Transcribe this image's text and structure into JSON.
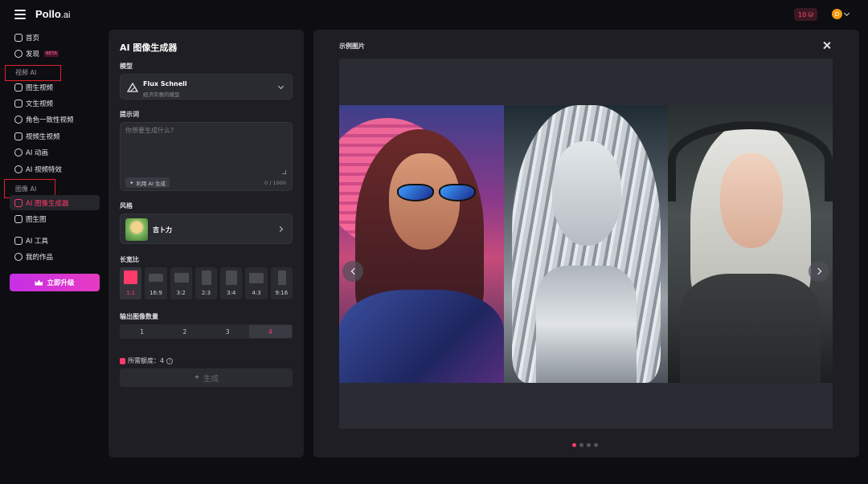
{
  "app": {
    "logo": "Pollo",
    "logo_suffix": ".ai",
    "credits": "10",
    "user_initial": "D"
  },
  "sidebar": {
    "items_top": [
      {
        "label": "首页",
        "icon": "home-icon"
      },
      {
        "label": "发现",
        "icon": "compass-icon",
        "badge": "BETA"
      }
    ],
    "video_section": "视频 AI",
    "video_items": [
      {
        "label": "图生视频",
        "icon": "image-video-icon"
      },
      {
        "label": "文生视频",
        "icon": "text-video-icon"
      },
      {
        "label": "角色一致性视频",
        "icon": "character-icon"
      },
      {
        "label": "视频生视频",
        "icon": "video-video-icon"
      },
      {
        "label": "AI 动画",
        "icon": "animation-icon"
      },
      {
        "label": "AI 视频特效",
        "icon": "effects-icon"
      }
    ],
    "image_section": "图像 AI",
    "image_items": [
      {
        "label": "AI 图像生成器",
        "icon": "image-generator-icon",
        "active": true
      },
      {
        "label": "图生图",
        "icon": "image-to-image-icon"
      }
    ],
    "bottom_items": [
      {
        "label": "AI 工具",
        "icon": "toolbox-icon"
      },
      {
        "label": "我的作品",
        "icon": "user-works-icon"
      }
    ],
    "upgrade": "立即升级"
  },
  "form": {
    "title": "AI 图像生成器",
    "model_label": "模型",
    "model_name": "Flux Schnell",
    "model_desc": "经济实惠的模型",
    "prompt_label": "提示词",
    "prompt_placeholder": "你想要生成什么?",
    "ai_generate": "利用 AI 生成",
    "char_count": "0 / 1000",
    "style_label": "风格",
    "style_name": "吉卜力",
    "ratio_label": "长宽比",
    "ratios": [
      "1:1",
      "16:9",
      "3:2",
      "2:3",
      "3:4",
      "4:3",
      "9:16"
    ],
    "count_label": "输出图像数量",
    "counts": [
      "1",
      "2",
      "3",
      "4"
    ],
    "selected_count": "4",
    "credits_required": "所需额度：4",
    "generate": "生成"
  },
  "preview": {
    "title": "示例图片",
    "slide_count": 4,
    "active_slide": 1
  },
  "colors": {
    "accent": "#ff3b6b",
    "panel": "#1e1e24",
    "background": "#0e0e12",
    "upgrade_gradient": [
      "#c72fe6",
      "#e63bc2"
    ]
  }
}
